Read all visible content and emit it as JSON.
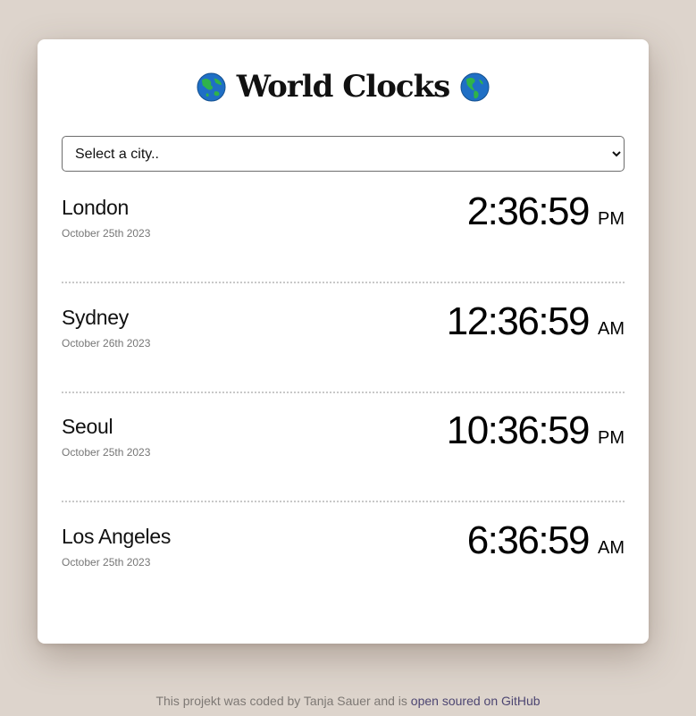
{
  "header": {
    "title": "World Clocks"
  },
  "selector": {
    "selected": "Select a city.."
  },
  "cities": [
    {
      "name": "London",
      "date": "October 25th 2023",
      "time": "2:36:59",
      "ampm": "PM"
    },
    {
      "name": "Sydney",
      "date": "October 26th 2023",
      "time": "12:36:59",
      "ampm": "AM"
    },
    {
      "name": "Seoul",
      "date": "October 25th 2023",
      "time": "10:36:59",
      "ampm": "PM"
    },
    {
      "name": "Los Angeles",
      "date": "October 25th 2023",
      "time": "6:36:59",
      "ampm": "AM"
    }
  ],
  "footer": {
    "text": "This projekt was coded by Tanja Sauer and is ",
    "link_label": "open soured on GitHub"
  },
  "colors": {
    "background": "#ddd4cc",
    "card": "#ffffff",
    "link": "#4d4672",
    "divider": "#c8c8c8"
  },
  "icons": {
    "globe_left": "globe-asia-icon",
    "globe_right": "globe-americas-icon"
  }
}
